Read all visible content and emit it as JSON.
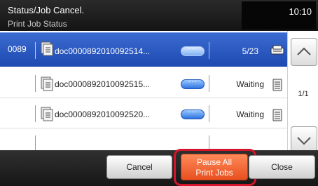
{
  "header": {
    "title": "Status/Job Cancel.",
    "subtitle": "Print Job Status",
    "clock": "10:10"
  },
  "jobs": [
    {
      "job_no": "0089",
      "name": "doc0000892010092514...",
      "status": "5/23",
      "selected": true
    },
    {
      "job_no": "",
      "name": "doc0000892010092515...",
      "status": "Waiting",
      "selected": false
    },
    {
      "job_no": "",
      "name": "doc0000892010092520...",
      "status": "Waiting",
      "selected": false
    }
  ],
  "pager": "1/1",
  "footer": {
    "cancel": "Cancel",
    "pause_line1": "Pause All",
    "pause_line2": "Print Jobs",
    "close": "Close"
  },
  "colors": {
    "selected_row": "#2a5bc4",
    "pause_button": "#f06a35",
    "highlight_frame": "#d4142a"
  }
}
